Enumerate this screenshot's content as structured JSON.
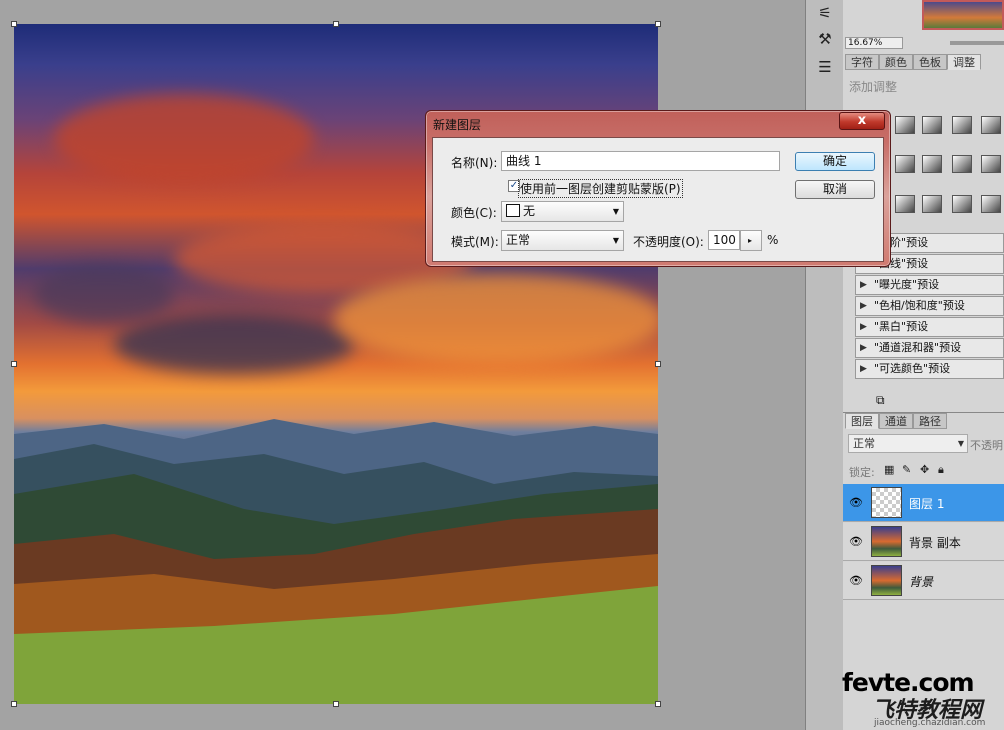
{
  "navigator": {
    "zoom": "16.67%"
  },
  "panel_tabs": [
    "字符",
    "颜色",
    "色板",
    "调整"
  ],
  "adjustments": {
    "add_label": "添加调整",
    "presets": [
      "\"色阶\"预设",
      "\"曲线\"预设",
      "\"曝光度\"预设",
      "\"色相/饱和度\"预设",
      "\"黑白\"预设",
      "\"通道混和器\"预设",
      "\"可选颜色\"预设"
    ]
  },
  "layers_panel": {
    "tabs": [
      "图层",
      "通道",
      "路径"
    ],
    "blend_mode": "正常",
    "opacity_label": "不透明",
    "lock_label": "锁定:",
    "layers": [
      {
        "name": "图层 1",
        "selected": true
      },
      {
        "name": "背景 副本",
        "selected": false
      },
      {
        "name": "背景",
        "selected": false
      }
    ]
  },
  "dialog": {
    "title": "新建图层",
    "close": "x",
    "name_label": "名称(N):",
    "name_value": "曲线 1",
    "clip_label": "使用前一图层创建剪贴蒙版(P)",
    "clip_checked": "✓",
    "color_label": "颜色(C):",
    "color_value": "无",
    "mode_label": "模式(M):",
    "mode_value": "正常",
    "opacity_label": "不透明度(O):",
    "opacity_value": "100",
    "opacity_unit": "%",
    "ok": "确定",
    "cancel": "取消"
  },
  "watermark": {
    "line1": "fevte.com",
    "line2": "飞特教程网",
    "line3": "jiaocheng.chazidian.com"
  }
}
